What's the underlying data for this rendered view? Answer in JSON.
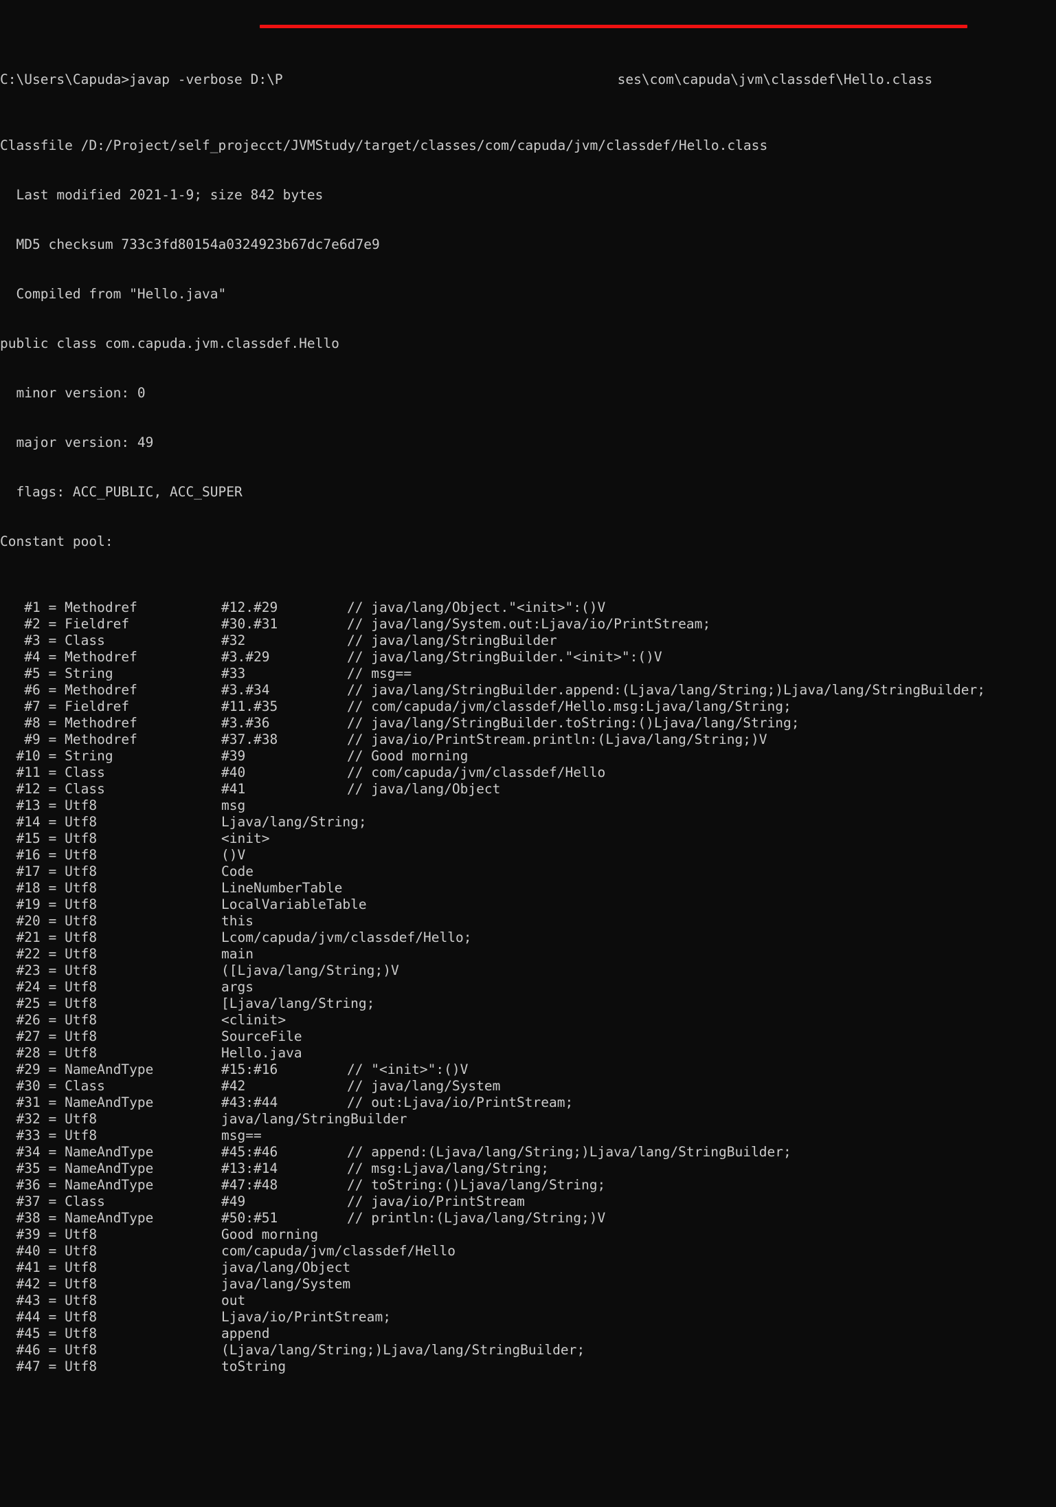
{
  "terminal": {
    "background_color": "#0c0c0c",
    "foreground_color": "#cccccc",
    "annotation_color": "#ee1111",
    "prompt": "C:\\Users\\Capuda>",
    "command": "javap -verbose D:\\P",
    "command_tail": "ses\\com\\capuda\\jvm\\classdef\\Hello.class",
    "redacted_label": "mosaic-redacted-path"
  },
  "header": {
    "classfile": "Classfile /D:/Project/self_projecct/JVMStudy/target/classes/com/capuda/jvm/classdef/Hello.class",
    "last_modified": "  Last modified 2021-1-9; size 842 bytes",
    "md5": "  MD5 checksum 733c3fd80154a0324923b67dc7e6d7e9",
    "compiled_from": "  Compiled from \"Hello.java\"",
    "class_decl": "public class com.capuda.jvm.classdef.Hello",
    "minor_version": "  minor version: 0",
    "major_version": "  major version: 49",
    "flags": "  flags: ACC_PUBLIC, ACC_SUPER",
    "constant_pool_label": "Constant pool:"
  },
  "constant_pool": [
    {
      "idx": "   #1 = Methodref",
      "ref": "#12.#29",
      "cmt": "// java/lang/Object.\"<init>\":()V"
    },
    {
      "idx": "   #2 = Fieldref",
      "ref": "#30.#31",
      "cmt": "// java/lang/System.out:Ljava/io/PrintStream;"
    },
    {
      "idx": "   #3 = Class",
      "ref": "#32",
      "cmt": "// java/lang/StringBuilder"
    },
    {
      "idx": "   #4 = Methodref",
      "ref": "#3.#29",
      "cmt": "// java/lang/StringBuilder.\"<init>\":()V"
    },
    {
      "idx": "   #5 = String",
      "ref": "#33",
      "cmt": "// msg=="
    },
    {
      "idx": "   #6 = Methodref",
      "ref": "#3.#34",
      "cmt": "// java/lang/StringBuilder.append:(Ljava/lang/String;)Ljava/lang/StringBuilder;"
    },
    {
      "idx": "   #7 = Fieldref",
      "ref": "#11.#35",
      "cmt": "// com/capuda/jvm/classdef/Hello.msg:Ljava/lang/String;"
    },
    {
      "idx": "   #8 = Methodref",
      "ref": "#3.#36",
      "cmt": "// java/lang/StringBuilder.toString:()Ljava/lang/String;"
    },
    {
      "idx": "   #9 = Methodref",
      "ref": "#37.#38",
      "cmt": "// java/io/PrintStream.println:(Ljava/lang/String;)V"
    },
    {
      "idx": "  #10 = String",
      "ref": "#39",
      "cmt": "// Good morning"
    },
    {
      "idx": "  #11 = Class",
      "ref": "#40",
      "cmt": "// com/capuda/jvm/classdef/Hello"
    },
    {
      "idx": "  #12 = Class",
      "ref": "#41",
      "cmt": "// java/lang/Object"
    },
    {
      "idx": "  #13 = Utf8",
      "ref": "msg",
      "cmt": ""
    },
    {
      "idx": "  #14 = Utf8",
      "ref": "Ljava/lang/String;",
      "cmt": ""
    },
    {
      "idx": "  #15 = Utf8",
      "ref": "<init>",
      "cmt": ""
    },
    {
      "idx": "  #16 = Utf8",
      "ref": "()V",
      "cmt": ""
    },
    {
      "idx": "  #17 = Utf8",
      "ref": "Code",
      "cmt": ""
    },
    {
      "idx": "  #18 = Utf8",
      "ref": "LineNumberTable",
      "cmt": ""
    },
    {
      "idx": "  #19 = Utf8",
      "ref": "LocalVariableTable",
      "cmt": ""
    },
    {
      "idx": "  #20 = Utf8",
      "ref": "this",
      "cmt": ""
    },
    {
      "idx": "  #21 = Utf8",
      "ref": "Lcom/capuda/jvm/classdef/Hello;",
      "cmt": ""
    },
    {
      "idx": "  #22 = Utf8",
      "ref": "main",
      "cmt": ""
    },
    {
      "idx": "  #23 = Utf8",
      "ref": "([Ljava/lang/String;)V",
      "cmt": ""
    },
    {
      "idx": "  #24 = Utf8",
      "ref": "args",
      "cmt": ""
    },
    {
      "idx": "  #25 = Utf8",
      "ref": "[Ljava/lang/String;",
      "cmt": ""
    },
    {
      "idx": "  #26 = Utf8",
      "ref": "<clinit>",
      "cmt": ""
    },
    {
      "idx": "  #27 = Utf8",
      "ref": "SourceFile",
      "cmt": ""
    },
    {
      "idx": "  #28 = Utf8",
      "ref": "Hello.java",
      "cmt": ""
    },
    {
      "idx": "  #29 = NameAndType",
      "ref": "#15:#16",
      "cmt": "// \"<init>\":()V"
    },
    {
      "idx": "  #30 = Class",
      "ref": "#42",
      "cmt": "// java/lang/System"
    },
    {
      "idx": "  #31 = NameAndType",
      "ref": "#43:#44",
      "cmt": "// out:Ljava/io/PrintStream;"
    },
    {
      "idx": "  #32 = Utf8",
      "ref": "java/lang/StringBuilder",
      "cmt": ""
    },
    {
      "idx": "  #33 = Utf8",
      "ref": "msg==",
      "cmt": ""
    },
    {
      "idx": "  #34 = NameAndType",
      "ref": "#45:#46",
      "cmt": "// append:(Ljava/lang/String;)Ljava/lang/StringBuilder;"
    },
    {
      "idx": "  #35 = NameAndType",
      "ref": "#13:#14",
      "cmt": "// msg:Ljava/lang/String;"
    },
    {
      "idx": "  #36 = NameAndType",
      "ref": "#47:#48",
      "cmt": "// toString:()Ljava/lang/String;"
    },
    {
      "idx": "  #37 = Class",
      "ref": "#49",
      "cmt": "// java/io/PrintStream"
    },
    {
      "idx": "  #38 = NameAndType",
      "ref": "#50:#51",
      "cmt": "// println:(Ljava/lang/String;)V"
    },
    {
      "idx": "  #39 = Utf8",
      "ref": "Good morning",
      "cmt": ""
    },
    {
      "idx": "  #40 = Utf8",
      "ref": "com/capuda/jvm/classdef/Hello",
      "cmt": ""
    },
    {
      "idx": "  #41 = Utf8",
      "ref": "java/lang/Object",
      "cmt": ""
    },
    {
      "idx": "  #42 = Utf8",
      "ref": "java/lang/System",
      "cmt": ""
    },
    {
      "idx": "  #43 = Utf8",
      "ref": "out",
      "cmt": ""
    },
    {
      "idx": "  #44 = Utf8",
      "ref": "Ljava/io/PrintStream;",
      "cmt": ""
    },
    {
      "idx": "  #45 = Utf8",
      "ref": "append",
      "cmt": ""
    },
    {
      "idx": "  #46 = Utf8",
      "ref": "(Ljava/lang/String;)Ljava/lang/StringBuilder;",
      "cmt": ""
    },
    {
      "idx": "  #47 = Utf8",
      "ref": "toString",
      "cmt": ""
    }
  ]
}
